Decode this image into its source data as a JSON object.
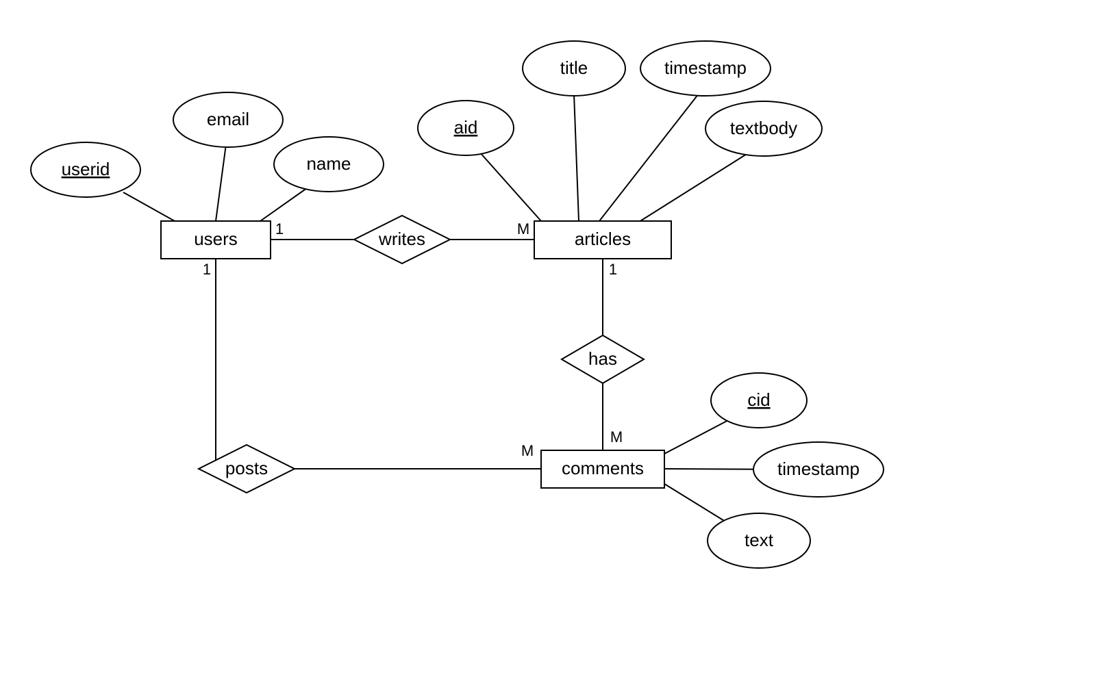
{
  "entities": {
    "users": {
      "label": "users"
    },
    "articles": {
      "label": "articles"
    },
    "comments": {
      "label": "comments"
    }
  },
  "relationships": {
    "writes": {
      "label": "writes"
    },
    "has": {
      "label": "has"
    },
    "posts": {
      "label": "posts"
    }
  },
  "attributes": {
    "userid": {
      "label": "userid",
      "key": true
    },
    "email": {
      "label": "email",
      "key": false
    },
    "name": {
      "label": "name",
      "key": false
    },
    "aid": {
      "label": "aid",
      "key": true
    },
    "title": {
      "label": "title",
      "key": false
    },
    "a_timestamp": {
      "label": "timestamp",
      "key": false
    },
    "textbody": {
      "label": "textbody",
      "key": false
    },
    "cid": {
      "label": "cid",
      "key": true
    },
    "c_timestamp": {
      "label": "timestamp",
      "key": false
    },
    "text": {
      "label": "text",
      "key": false
    }
  },
  "cardinalities": {
    "users_writes": "1",
    "articles_writes": "M",
    "users_posts": "1",
    "comments_posts": "M",
    "articles_has": "1",
    "comments_has": "M"
  }
}
